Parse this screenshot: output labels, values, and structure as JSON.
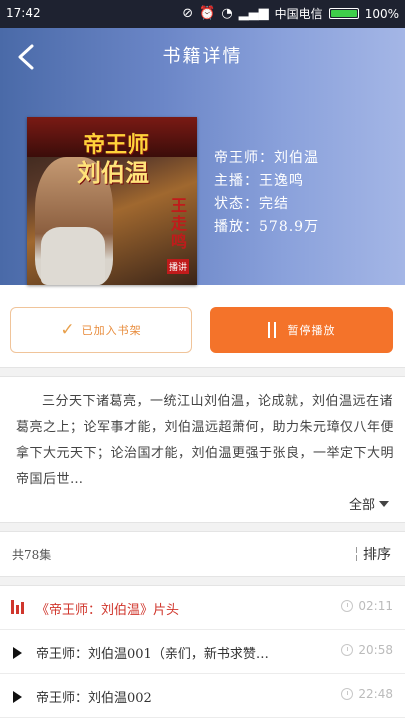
{
  "status_bar": {
    "time": "17:42",
    "carrier": "中国电信",
    "battery": "100%",
    "battery_level": 1.0
  },
  "header": {
    "title": "书籍详情"
  },
  "book": {
    "cover_text": {
      "line1": "帝王师",
      "line2": "刘伯温",
      "narrator_mark": "王走鸣",
      "badge": "播讲"
    },
    "info": {
      "name": "帝王师：刘伯温",
      "narrator": "主播：王逸鸣",
      "status": "状态：完结",
      "plays": "播放：578.9万"
    }
  },
  "actions": {
    "shelf_label": "已加入书架",
    "pause_label": "暂停播放"
  },
  "description": {
    "text": "三分天下诸葛亮，一统江山刘伯温，论成就，刘伯温远在诸葛亮之上；论军事才能，刘伯温远超萧何，助力朱元璋仅八年便拿下大元天下；论治国才能，刘伯温更强于张良，一举定下大明帝国后世…",
    "more_label": "全部"
  },
  "episodes": {
    "count_label": "共78集",
    "sort_label": "排序",
    "items": [
      {
        "title": "《帝王师：刘伯温》片头",
        "duration": "02:11",
        "playing": true
      },
      {
        "title": "帝王师：刘伯温001（亲们，新书求赞…",
        "duration": "20:58",
        "playing": false
      },
      {
        "title": "帝王师：刘伯温002",
        "duration": "22:48",
        "playing": false
      }
    ]
  },
  "colors": {
    "accent": "#f4732a",
    "playing": "#d0362c"
  }
}
